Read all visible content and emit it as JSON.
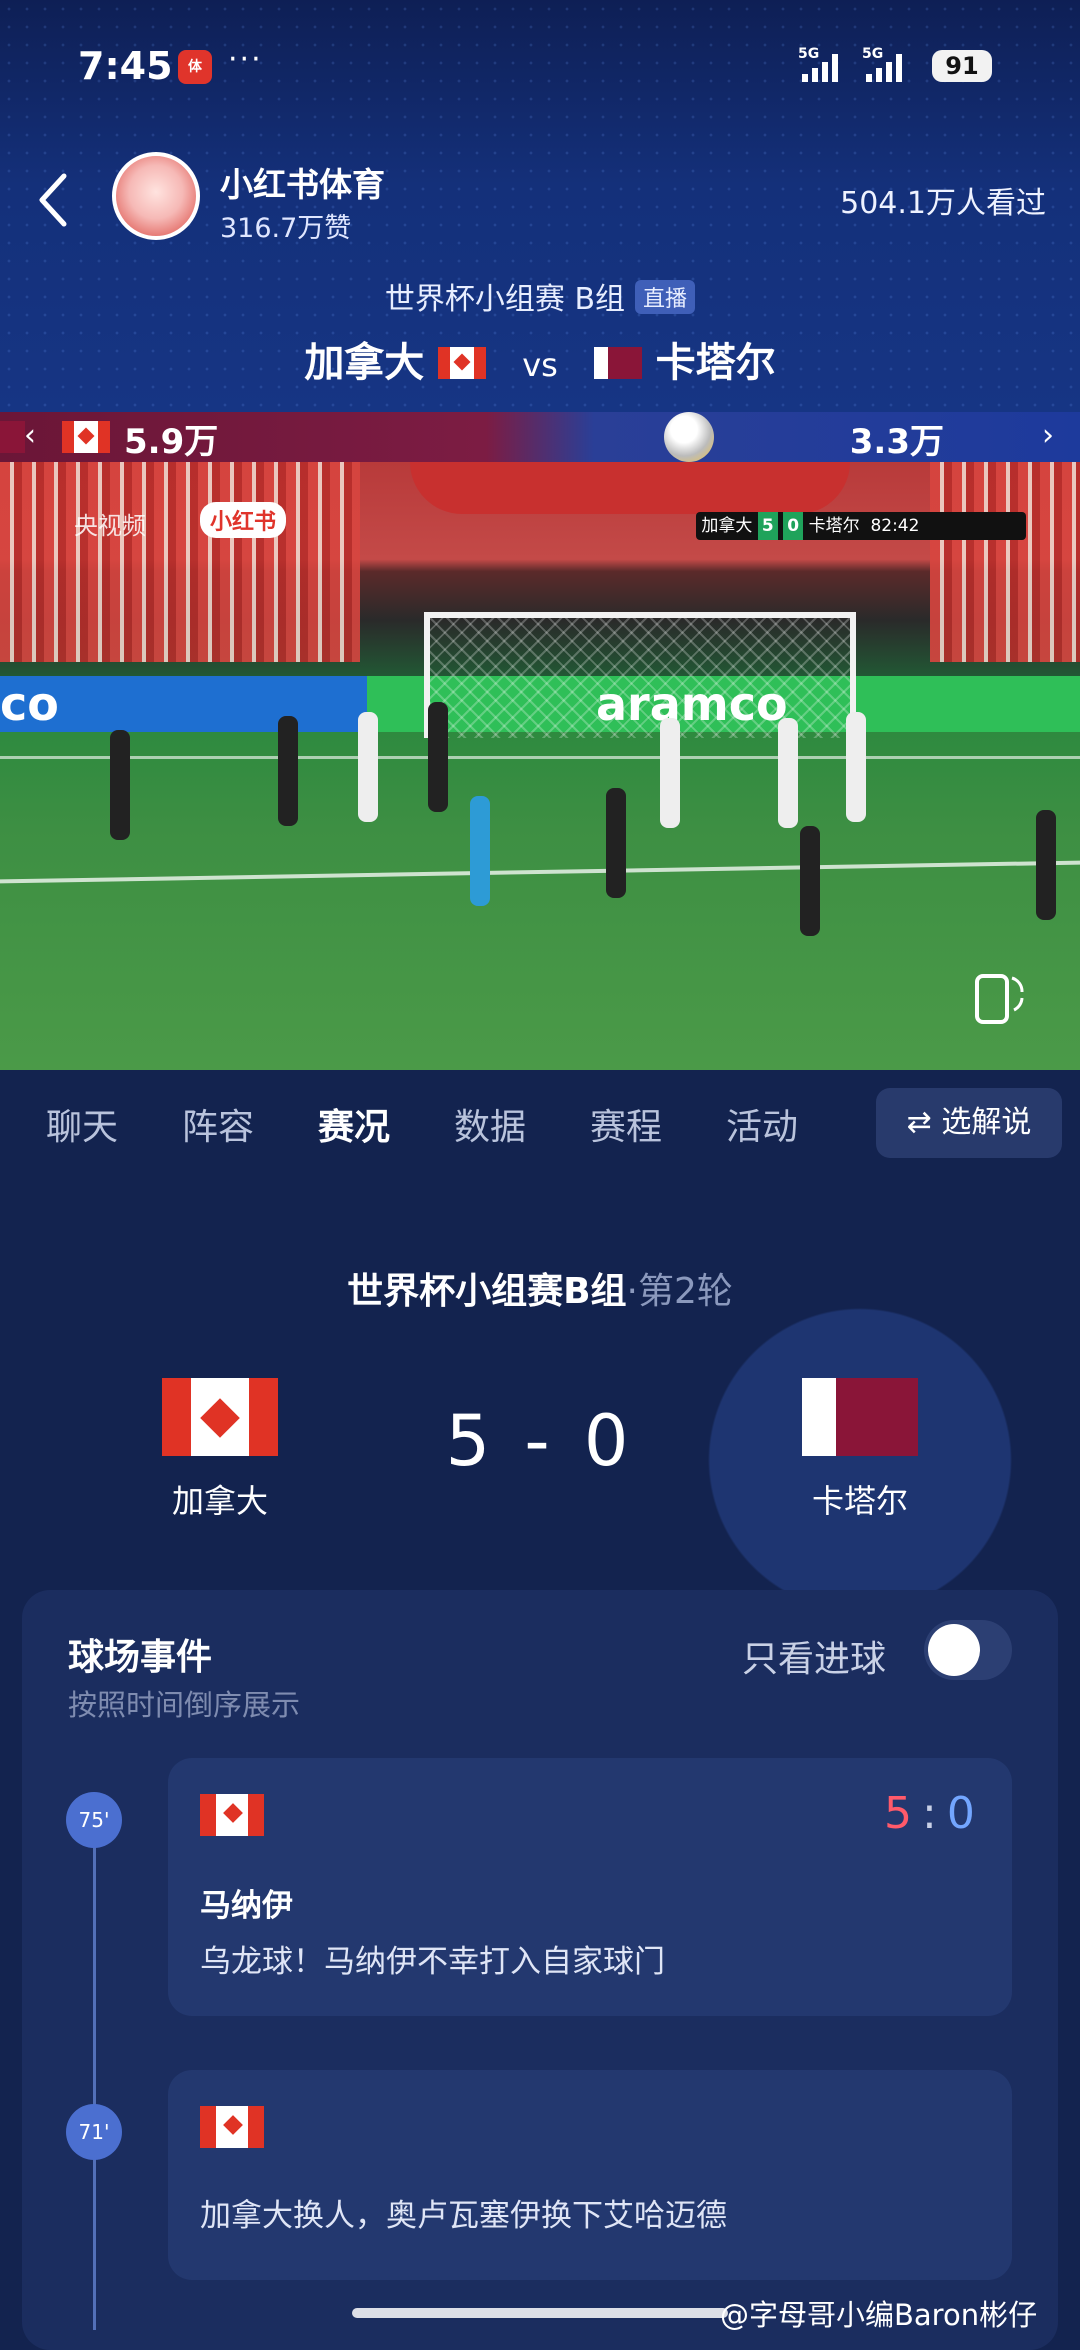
{
  "status_bar": {
    "time": "7:45",
    "app_icon_text": "体",
    "more": "···",
    "network1": "5G",
    "network2": "5G",
    "battery": "91"
  },
  "header": {
    "channel_name": "小红书体育",
    "likes": "316.7万赞",
    "viewers": "504.1万人看过"
  },
  "match_header": {
    "subtitle": "世界杯小组赛 B组",
    "live_badge": "直播",
    "home": "加拿大",
    "vs": "vs",
    "away": "卡塔尔"
  },
  "support_bar": {
    "home_value": "5.9万",
    "away_value": "3.3万"
  },
  "video": {
    "ad_text": "aramco",
    "ad_text_left": "co",
    "watermark_cctv": "央视频",
    "watermark_app": "小红书",
    "scorebug": {
      "home": "加拿大",
      "home_score": "5",
      "away_score": "0",
      "away": "卡塔尔",
      "clock": "82:42"
    }
  },
  "tabs": [
    {
      "label": "聊天",
      "active": false
    },
    {
      "label": "阵容",
      "active": false
    },
    {
      "label": "赛况",
      "active": true
    },
    {
      "label": "数据",
      "active": false
    },
    {
      "label": "赛程",
      "active": false
    },
    {
      "label": "活动",
      "active": false
    }
  ],
  "commentary_button": "⇄ 选解说",
  "match_info": {
    "competition": "世界杯小组赛B组",
    "round": "·第2轮",
    "home_name": "加拿大",
    "away_name": "卡塔尔",
    "score": "5 - 0"
  },
  "events": {
    "title": "球场事件",
    "subtitle": "按照时间倒序展示",
    "goals_only_label": "只看进球",
    "items": [
      {
        "minute": "75'",
        "score_home": "5",
        "score_sep": ":",
        "score_away": "0",
        "player": "马纳伊",
        "description": "乌龙球！马纳伊不幸打入自家球门"
      },
      {
        "minute": "71'",
        "description": "加拿大换人，奥卢瓦塞伊换下艾哈迈德"
      }
    ]
  },
  "watermark_credit": "@字母哥小编Baron彬仔"
}
